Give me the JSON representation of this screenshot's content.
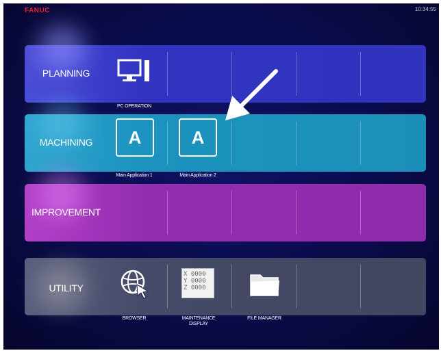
{
  "header": {
    "brand": "FANUC",
    "clock": "10:34:55"
  },
  "rows": {
    "planning": {
      "label": "PLANNING"
    },
    "machining": {
      "label": "MACHINING"
    },
    "improvement": {
      "label": "IMPROVEMENT"
    },
    "utility": {
      "label": "UTILITY"
    }
  },
  "apps": {
    "pc_operation": {
      "label": "PC OPERATION",
      "icon": "monitor-icon"
    },
    "main_app_1": {
      "label": "Main Application 1",
      "glyph": "A",
      "icon": "app-a-icon"
    },
    "main_app_2": {
      "label": "Main Application 2",
      "glyph": "A",
      "icon": "app-a-icon"
    },
    "browser": {
      "label": "BROWSER",
      "icon": "globe-cursor-icon"
    },
    "maintenance": {
      "label": "MAINTENANCE\nDISPLAY",
      "icon": "xyz-display-icon",
      "readout": [
        "X 0000",
        "Y 0000",
        "Z 0000"
      ]
    },
    "file_manager": {
      "label": "FILE MANAGER",
      "icon": "folder-icon"
    }
  },
  "colors": {
    "brand": "#e8202a",
    "planning": "#3134c0",
    "machining": "#1b93be",
    "improvement": "#932db0",
    "utility": "#454a68",
    "background": "#0a0b4a"
  }
}
